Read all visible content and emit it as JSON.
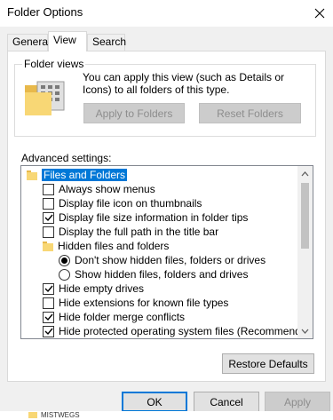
{
  "window": {
    "title": "Folder Options"
  },
  "tabs": [
    {
      "label": "General",
      "active": false
    },
    {
      "label": "View",
      "active": true
    },
    {
      "label": "Search",
      "active": false
    }
  ],
  "folder_views": {
    "legend": "Folder views",
    "description": "You can apply this view (such as Details or Icons) to all folders of this type.",
    "apply_button": "Apply to Folders",
    "reset_button": "Reset Folders"
  },
  "advanced": {
    "label": "Advanced settings:",
    "items": [
      {
        "type": "folder",
        "label": "Files and Folders",
        "selected": true
      },
      {
        "type": "checkbox",
        "label": "Always show menus",
        "checked": false
      },
      {
        "type": "checkbox",
        "label": "Display file icon on thumbnails",
        "checked": false
      },
      {
        "type": "checkbox",
        "label": "Display file size information in folder tips",
        "checked": true
      },
      {
        "type": "checkbox",
        "label": "Display the full path in the title bar",
        "checked": false
      },
      {
        "type": "folder",
        "label": "Hidden files and folders",
        "selected": false
      },
      {
        "type": "radio",
        "label": "Don't show hidden files, folders or drives",
        "checked": true
      },
      {
        "type": "radio",
        "label": "Show hidden files, folders and drives",
        "checked": false
      },
      {
        "type": "checkbox",
        "label": "Hide empty drives",
        "checked": true
      },
      {
        "type": "checkbox",
        "label": "Hide extensions for known file types",
        "checked": false
      },
      {
        "type": "checkbox",
        "label": "Hide folder merge conflicts",
        "checked": true
      },
      {
        "type": "checkbox",
        "label": "Hide protected operating system files (Recommended)",
        "checked": true
      }
    ]
  },
  "buttons": {
    "restore_defaults": "Restore Defaults",
    "ok": "OK",
    "cancel": "Cancel",
    "apply": "Apply"
  },
  "background_peek": "MISTWEGS",
  "colors": {
    "selection": "#0078d7",
    "folder": "#f8d775",
    "folder_dark": "#e8b94b"
  }
}
